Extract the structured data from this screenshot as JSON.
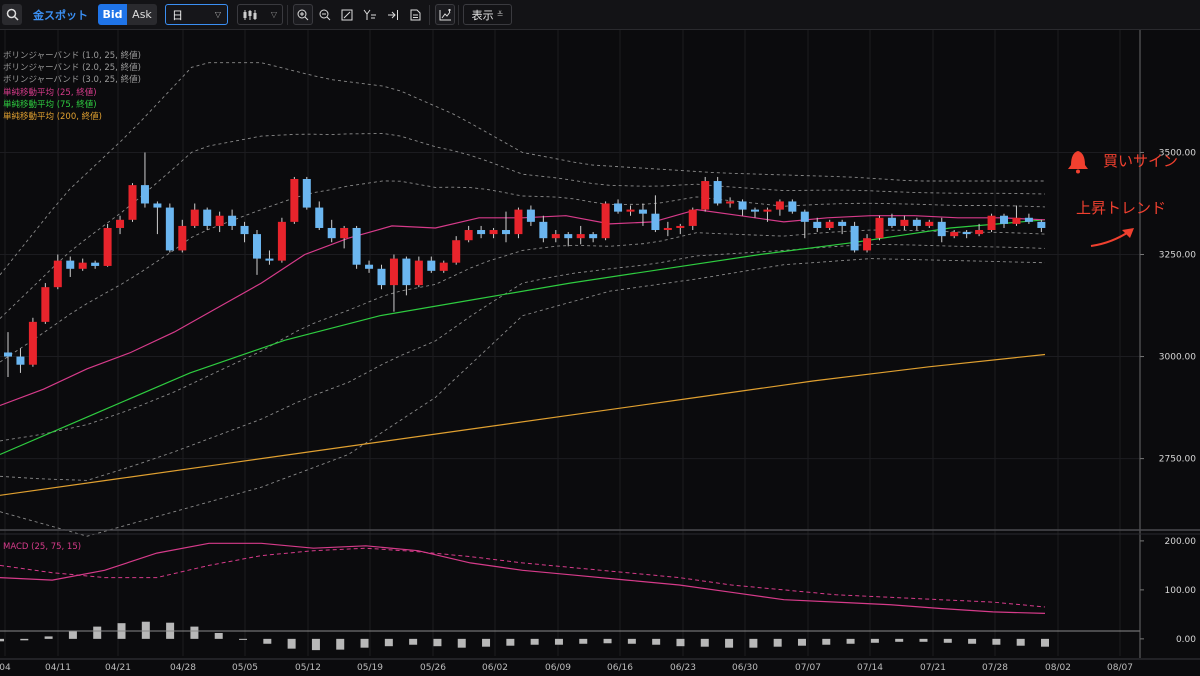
{
  "toolbar": {
    "symbol": "金スポット",
    "bid_label": "Bid",
    "ask_label": "Ask",
    "period_value": "日",
    "display_label": "表示"
  },
  "legend": [
    {
      "label": "ボリンジャーバンド (1.0, 25, 終値)",
      "color": "#9a9a9a"
    },
    {
      "label": "ボリンジャーバンド (2.0, 25, 終値)",
      "color": "#9a9a9a"
    },
    {
      "label": "ボリンジャーバンド (3.0, 25, 終値)",
      "color": "#9a9a9a"
    },
    {
      "label": "単純移動平均 (25, 終値)",
      "color": "#d63b8a"
    },
    {
      "label": "単純移動平均 (75, 終値)",
      "color": "#2ecc40"
    },
    {
      "label": "単純移動平均 (200, 終値)",
      "color": "#e0a030"
    }
  ],
  "macd_label": "MACD (25, 75, 15)",
  "annotations": {
    "buy_sign": "買いサイン",
    "uptrend": "上昇トレンド"
  },
  "colors": {
    "up": "#e8242c",
    "down": "#6bb6f0",
    "sma25": "#d63b8a",
    "sma75": "#2ecc40",
    "sma200": "#e0a030",
    "macd": "#d63b8a",
    "signal": "#d63b8a",
    "histogram": "#b8b8b8",
    "annotation": "#f0402f"
  },
  "chart_data": {
    "type": "candlestick",
    "price_axis": {
      "ticks": [
        2750,
        3000,
        3250,
        3500
      ],
      "tick_labels": [
        "2750.00",
        "3000.00",
        "3250.00",
        "3500.00"
      ],
      "range": [
        2580,
        3800
      ]
    },
    "macd_axis": {
      "ticks": [
        0,
        100,
        200
      ],
      "tick_labels": [
        "0.00",
        "100.00",
        "200.00"
      ],
      "range": [
        -35,
        210
      ]
    },
    "x_ticks": [
      "04",
      "04/11",
      "04/21",
      "04/28",
      "05/05",
      "05/12",
      "05/19",
      "05/26",
      "06/02",
      "06/09",
      "06/16",
      "06/23",
      "06/30",
      "07/07",
      "07/14",
      "07/21",
      "07/28",
      "08/02",
      "08/07"
    ],
    "candles": [
      [
        3010,
        3000,
        3060,
        2950
      ],
      [
        3000,
        2980,
        3020,
        2960
      ],
      [
        2980,
        3085,
        3095,
        2975
      ],
      [
        3085,
        3170,
        3180,
        3080
      ],
      [
        3170,
        3235,
        3250,
        3165
      ],
      [
        3235,
        3215,
        3245,
        3195
      ],
      [
        3215,
        3230,
        3240,
        3210
      ],
      [
        3230,
        3222,
        3235,
        3215
      ],
      [
        3222,
        3315,
        3325,
        3220
      ],
      [
        3315,
        3335,
        3345,
        3300
      ],
      [
        3335,
        3420,
        3425,
        3330
      ],
      [
        3420,
        3375,
        3500,
        3365
      ],
      [
        3375,
        3365,
        3380,
        3300
      ],
      [
        3365,
        3260,
        3375,
        3255
      ],
      [
        3260,
        3320,
        3335,
        3255
      ],
      [
        3320,
        3360,
        3375,
        3315
      ],
      [
        3360,
        3320,
        3365,
        3310
      ],
      [
        3320,
        3345,
        3355,
        3305
      ],
      [
        3345,
        3320,
        3360,
        3310
      ],
      [
        3320,
        3300,
        3330,
        3280
      ],
      [
        3300,
        3240,
        3310,
        3200
      ],
      [
        3240,
        3235,
        3260,
        3225
      ],
      [
        3235,
        3330,
        3340,
        3230
      ],
      [
        3330,
        3435,
        3440,
        3325
      ],
      [
        3435,
        3365,
        3440,
        3360
      ],
      [
        3365,
        3315,
        3380,
        3310
      ],
      [
        3315,
        3290,
        3335,
        3280
      ],
      [
        3290,
        3315,
        3320,
        3265
      ],
      [
        3315,
        3225,
        3320,
        3215
      ],
      [
        3225,
        3215,
        3235,
        3205
      ],
      [
        3215,
        3175,
        3225,
        3165
      ],
      [
        3175,
        3240,
        3250,
        3110
      ],
      [
        3240,
        3175,
        3245,
        3150
      ],
      [
        3175,
        3235,
        3245,
        3170
      ],
      [
        3235,
        3210,
        3245,
        3205
      ],
      [
        3210,
        3230,
        3235,
        3205
      ],
      [
        3230,
        3285,
        3295,
        3225
      ],
      [
        3285,
        3310,
        3320,
        3280
      ],
      [
        3310,
        3300,
        3320,
        3290
      ],
      [
        3300,
        3310,
        3315,
        3290
      ],
      [
        3310,
        3300,
        3355,
        3280
      ],
      [
        3300,
        3360,
        3365,
        3290
      ],
      [
        3360,
        3330,
        3370,
        3320
      ],
      [
        3330,
        3290,
        3345,
        3280
      ],
      [
        3290,
        3300,
        3310,
        3280
      ],
      [
        3300,
        3290,
        3305,
        3270
      ],
      [
        3290,
        3300,
        3320,
        3275
      ],
      [
        3300,
        3290,
        3305,
        3280
      ],
      [
        3290,
        3375,
        3380,
        3285
      ],
      [
        3375,
        3355,
        3385,
        3350
      ],
      [
        3355,
        3360,
        3370,
        3345
      ],
      [
        3360,
        3350,
        3375,
        3320
      ],
      [
        3350,
        3310,
        3395,
        3305
      ],
      [
        3310,
        3315,
        3330,
        3295
      ],
      [
        3315,
        3320,
        3325,
        3300
      ],
      [
        3320,
        3360,
        3365,
        3310
      ],
      [
        3360,
        3430,
        3440,
        3355
      ],
      [
        3430,
        3375,
        3440,
        3370
      ],
      [
        3375,
        3380,
        3390,
        3365
      ],
      [
        3380,
        3360,
        3385,
        3345
      ],
      [
        3360,
        3355,
        3365,
        3340
      ],
      [
        3355,
        3360,
        3365,
        3330
      ],
      [
        3360,
        3380,
        3385,
        3345
      ],
      [
        3380,
        3355,
        3385,
        3350
      ],
      [
        3355,
        3330,
        3360,
        3290
      ],
      [
        3330,
        3315,
        3340,
        3305
      ],
      [
        3315,
        3330,
        3335,
        3310
      ],
      [
        3330,
        3320,
        3335,
        3300
      ],
      [
        3320,
        3260,
        3330,
        3255
      ],
      [
        3260,
        3290,
        3300,
        3255
      ],
      [
        3290,
        3340,
        3345,
        3285
      ],
      [
        3340,
        3320,
        3350,
        3315
      ],
      [
        3320,
        3335,
        3345,
        3310
      ],
      [
        3335,
        3320,
        3340,
        3310
      ],
      [
        3320,
        3330,
        3335,
        3315
      ],
      [
        3330,
        3295,
        3340,
        3280
      ],
      [
        3295,
        3305,
        3310,
        3290
      ],
      [
        3305,
        3300,
        3310,
        3290
      ],
      [
        3300,
        3310,
        3325,
        3295
      ],
      [
        3310,
        3345,
        3350,
        3305
      ],
      [
        3345,
        3325,
        3350,
        3315
      ],
      [
        3325,
        3340,
        3370,
        3320
      ],
      [
        3340,
        3330,
        3350,
        3325
      ],
      [
        3330,
        3315,
        3335,
        3305
      ],
      [
        3315,
        3340,
        3345,
        3310
      ],
      [
        3340,
        3335,
        3350,
        3325
      ],
      [
        3335,
        3390,
        3395,
        3330
      ],
      [
        3390,
        3425,
        3435,
        3385
      ],
      [
        3425,
        3385,
        3435,
        3375
      ],
      [
        3385,
        3365,
        3390,
        3355
      ],
      [
        3365,
        3340,
        3380,
        3330
      ],
      [
        3340,
        3310,
        3345,
        3305
      ],
      [
        3310,
        3315,
        3320,
        3300
      ],
      [
        3315,
        3265,
        3320,
        3260
      ],
      [
        3265,
        3280,
        3295,
        3260
      ],
      [
        3280,
        3360,
        3365,
        3275
      ]
    ],
    "sma25": [
      2880,
      2920,
      2970,
      3010,
      3060,
      3120,
      3180,
      3250,
      3290,
      3320,
      3315,
      3340,
      3340,
      3345,
      3325,
      3330,
      3360,
      3345,
      3330,
      3340,
      3345,
      3345,
      3340,
      3340,
      3335
    ],
    "sma75": [
      2760,
      2860,
      2960,
      3040,
      3100,
      3140,
      3180,
      3215,
      3250,
      3280,
      3315,
      3335
    ],
    "sma200": [
      2660,
      2700,
      2740,
      2780,
      2820,
      2860,
      2900,
      2940,
      2975,
      3005
    ],
    "bb3_upper": [
      3200,
      3400,
      3550,
      3720,
      3720,
      3680,
      3660,
      3590,
      3500,
      3470,
      3460,
      3450,
      3445,
      3440,
      3430,
      3430,
      3430
    ],
    "bb3_lower": [
      2620,
      2560,
      2620,
      2680,
      2760,
      2900,
      3100,
      3160,
      3190,
      3225,
      3240,
      3235,
      3230
    ],
    "macd": [
      125,
      120,
      140,
      175,
      195,
      195,
      185,
      190,
      180,
      155,
      140,
      130,
      120,
      110,
      95,
      80,
      75,
      70,
      62,
      55,
      52
    ],
    "signal": [
      150,
      135,
      125,
      125,
      150,
      170,
      180,
      185,
      178,
      168,
      155,
      145,
      135,
      125,
      110,
      100,
      90,
      85,
      80,
      75,
      65
    ],
    "histogram": [
      -5,
      -3,
      5,
      15,
      25,
      32,
      35,
      33,
      25,
      12,
      0,
      -10,
      -20,
      -23,
      -22,
      -18,
      -15,
      -12,
      -15,
      -18,
      -16,
      -14,
      -12,
      -12,
      -10,
      -9,
      -10,
      -12,
      -15,
      -16,
      -18,
      -18,
      -16,
      -14,
      -12,
      -10,
      -8,
      -6,
      -6,
      -8,
      -10,
      -12,
      -14,
      -16
    ]
  }
}
